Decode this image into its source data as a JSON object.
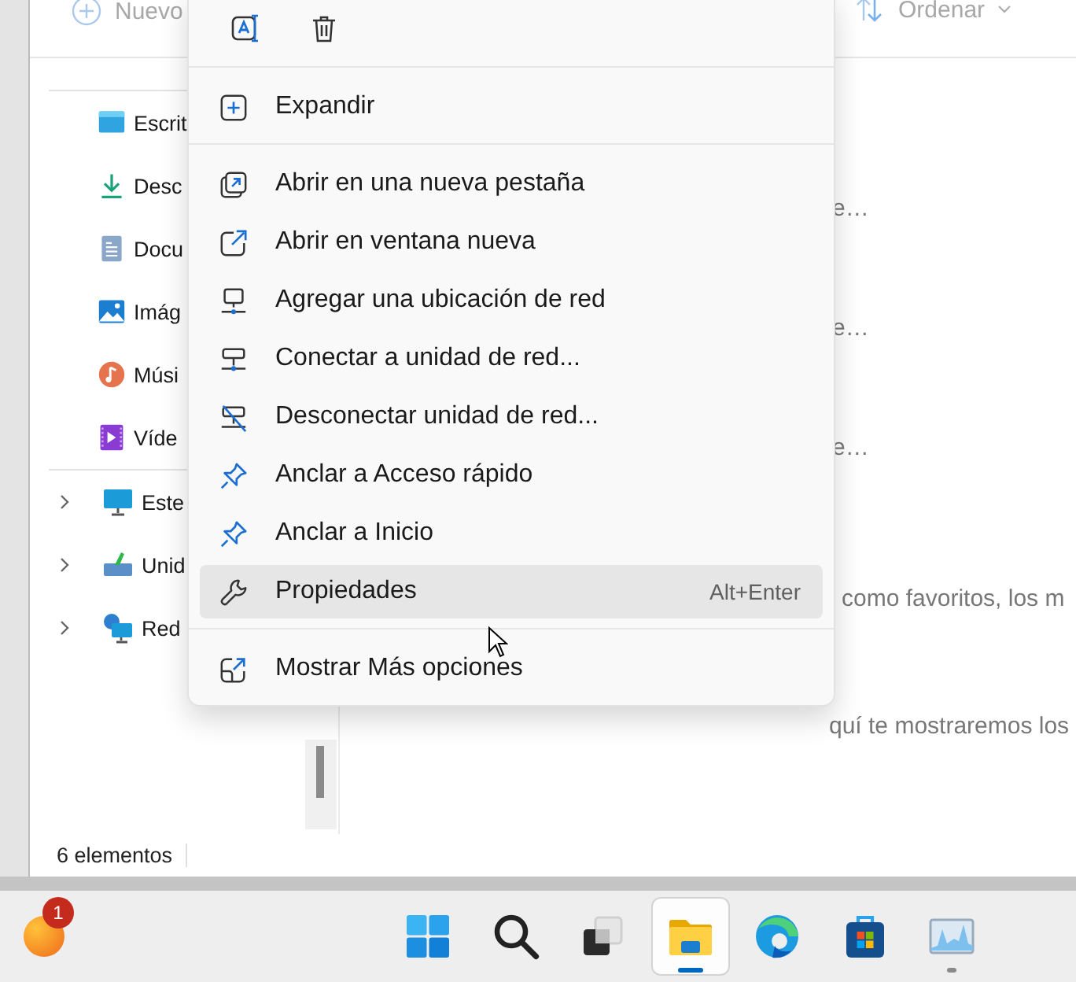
{
  "explorer": {
    "toolbar": {
      "new_button": {
        "label": "Nuevo",
        "disabled": true
      },
      "sort_button": {
        "label": "Ordenar",
        "disabled": true
      }
    },
    "nav_pane": {
      "quick_access": [
        {
          "label": "Escrit"
        },
        {
          "label": "Desc"
        },
        {
          "label": "Docu"
        },
        {
          "label": "Imág"
        },
        {
          "label": "Músi"
        },
        {
          "label": "Víde"
        }
      ],
      "locations": [
        {
          "label": "Este",
          "expanded": false
        },
        {
          "label": "Unid",
          "expanded": false
        },
        {
          "label": "Red",
          "expanded": false
        }
      ]
    },
    "content": {
      "lines": [
        "e…",
        "e…",
        "e…",
        "como favoritos, los m",
        "quí te mostraremos los"
      ]
    },
    "status_bar": {
      "item_count": "6 elementos"
    }
  },
  "context_menu": {
    "sections": [
      [
        {
          "label": "Expandir",
          "highlighted": false
        }
      ],
      [
        {
          "label": "Abrir en una nueva pestaña",
          "highlighted": false
        },
        {
          "label": "Abrir en ventana nueva",
          "highlighted": false
        },
        {
          "label": "Agregar una ubicación de red",
          "highlighted": false
        },
        {
          "label": "Conectar a unidad de red...",
          "highlighted": false
        },
        {
          "label": "Desconectar unidad de red...",
          "highlighted": false
        },
        {
          "label": "Anclar a Acceso rápido",
          "highlighted": false
        },
        {
          "label": "Anclar a Inicio",
          "highlighted": false
        },
        {
          "label": "Propiedades",
          "highlighted": true,
          "shortcut": "Alt+Enter"
        }
      ],
      [
        {
          "label": "Mostrar Más opciones",
          "highlighted": false
        }
      ]
    ]
  },
  "taskbar": {
    "widget": {
      "badge": "1"
    },
    "apps": [
      {
        "active": false,
        "running": false
      },
      {
        "active": false,
        "running": false
      },
      {
        "active": false,
        "running": false
      },
      {
        "active": true,
        "running": true
      },
      {
        "active": false,
        "running": false
      },
      {
        "active": false,
        "running": false
      },
      {
        "active": false,
        "running": true
      }
    ]
  }
}
